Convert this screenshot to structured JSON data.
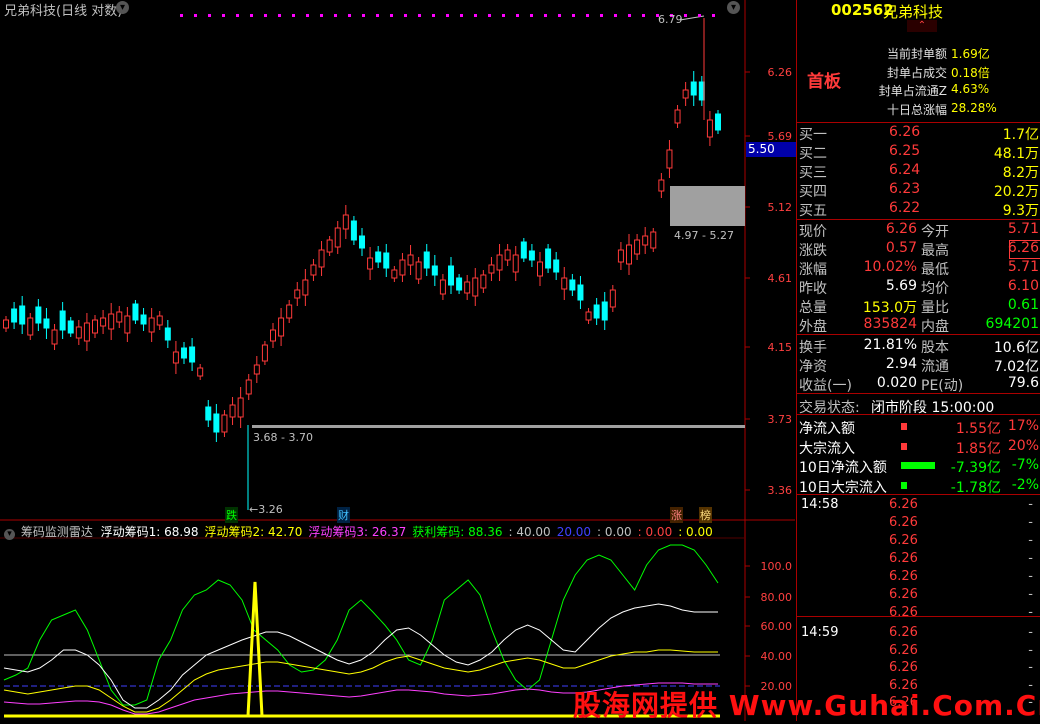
{
  "header": {
    "title": "兄弟科技(日线 对数)",
    "dropdown_icon": "chevron-down-icon"
  },
  "price_axis": [
    "6.26",
    "5.69",
    "5.12",
    "4.61",
    "4.15",
    "3.73",
    "3.36"
  ],
  "price_tag": "5.50",
  "annotations": {
    "high": "6.79",
    "low": "3.26",
    "range_low": "3.68 - 3.70",
    "range_mid": "4.97 - 5.27"
  },
  "bottom_markers": {
    "die": "跌",
    "cai": "财",
    "zhang": "涨",
    "bang": "榜"
  },
  "indicator": {
    "name": "筹码监测雷达",
    "items": [
      {
        "label": "浮动筹码1: 68.98",
        "color": "#ffffff"
      },
      {
        "label": "浮动筹码2: 42.70",
        "color": "#ffff00"
      },
      {
        "label": "浮动筹码3: 26.37",
        "color": "#ff40ff"
      },
      {
        "label": "获利筹码: 88.36",
        "color": "#00ff00"
      },
      {
        "label": ": 40.00",
        "color": "#c0c0c0"
      },
      {
        "label": "20.00",
        "color": "#4040ff"
      },
      {
        "label": ": 0.00",
        "color": "#c0c0c0"
      },
      {
        "label": ": 0.00",
        "color": "#ff4040"
      },
      {
        "label": ": 0.00",
        "color": "#ffff00"
      }
    ],
    "axis": [
      "100.0",
      "80.00",
      "60.00",
      "40.00",
      "20.00"
    ]
  },
  "stock": {
    "code": "002562",
    "name": "兄弟科技",
    "tag": "首板"
  },
  "seal": [
    {
      "label": "当前封单额",
      "value": "1.69亿"
    },
    {
      "label": "封单占成交",
      "value": "0.18倍"
    },
    {
      "label": "封单占流通Z",
      "value": "4.63%"
    },
    {
      "label": "十日总涨幅",
      "value": "28.28%"
    }
  ],
  "bids": [
    {
      "label": "买一",
      "price": "6.26",
      "vol": "1.7亿"
    },
    {
      "label": "买二",
      "price": "6.25",
      "vol": "48.1万"
    },
    {
      "label": "买三",
      "price": "6.24",
      "vol": "8.2万"
    },
    {
      "label": "买四",
      "price": "6.23",
      "vol": "20.2万"
    },
    {
      "label": "买五",
      "price": "6.22",
      "vol": "9.3万"
    }
  ],
  "quote": [
    {
      "l1": "现价",
      "v1": "6.26",
      "l2": "今开",
      "v2": "5.71",
      "c1": "red",
      "c2": "red"
    },
    {
      "l1": "涨跌",
      "v1": "0.57",
      "l2": "最高",
      "v2": "6.26",
      "c1": "red",
      "c2": "red"
    },
    {
      "l1": "涨幅",
      "v1": "10.02%",
      "l2": "最低",
      "v2": "5.71",
      "c1": "red",
      "c2": "red"
    },
    {
      "l1": "昨收",
      "v1": "5.69",
      "l2": "均价",
      "v2": "6.10",
      "c1": "wht",
      "c2": "red"
    },
    {
      "l1": "总量",
      "v1": "153.0万",
      "l2": "量比",
      "v2": "0.61",
      "c1": "yel",
      "c2": "grn"
    },
    {
      "l1": "外盘",
      "v1": "835824",
      "l2": "内盘",
      "v2": "694201",
      "c1": "red",
      "c2": "grn"
    }
  ],
  "fund": [
    {
      "l1": "换手",
      "v1": "21.81%",
      "l2": "股本",
      "v2": "10.6亿"
    },
    {
      "l1": "净资",
      "v1": "2.94",
      "l2": "流通",
      "v2": "7.02亿"
    },
    {
      "l1": "收益(一)",
      "v1": "0.020",
      "l2": "PE(动)",
      "v2": "79.6"
    }
  ],
  "trade_status": {
    "label": "交易状态:",
    "value": "闭市阶段 15:00:00"
  },
  "flows": [
    {
      "label": "净流入额",
      "amount": "1.55亿",
      "pct": "17%",
      "color": "#ff3a3a",
      "bar": 6
    },
    {
      "label": "大宗流入",
      "amount": "1.85亿",
      "pct": "20%",
      "color": "#ff3a3a",
      "bar": 6
    },
    {
      "label": "10日净流入额",
      "amount": "-7.39亿",
      "pct": "-7%",
      "color": "#00ff00",
      "bar": 34
    },
    {
      "label": "10日大宗流入",
      "amount": "-1.78亿",
      "pct": "-2%",
      "color": "#00ff00",
      "bar": 6
    }
  ],
  "ticks": [
    {
      "time": "14:58",
      "price": "6.26",
      "vol": "-"
    },
    {
      "time": "",
      "price": "6.26",
      "vol": "-"
    },
    {
      "time": "",
      "price": "6.26",
      "vol": "-"
    },
    {
      "time": "",
      "price": "6.26",
      "vol": "-"
    },
    {
      "time": "",
      "price": "6.26",
      "vol": "-"
    },
    {
      "time": "",
      "price": "6.26",
      "vol": "-"
    },
    {
      "time": "",
      "price": "6.26",
      "vol": "-"
    },
    {
      "time": "14:59",
      "price": "6.26",
      "vol": "-"
    },
    {
      "time": "",
      "price": "6.26",
      "vol": "-"
    },
    {
      "time": "",
      "price": "6.26",
      "vol": "-"
    },
    {
      "time": "",
      "price": "6.26",
      "vol": "-"
    },
    {
      "time": "",
      "price": "6.26",
      "vol": "-"
    }
  ],
  "watermark": "股海网提供 Www.Guhai.Com.Cn",
  "colors": {
    "up": "#ff3a3a",
    "down": "#00ffff",
    "border": "#aa0000"
  }
}
